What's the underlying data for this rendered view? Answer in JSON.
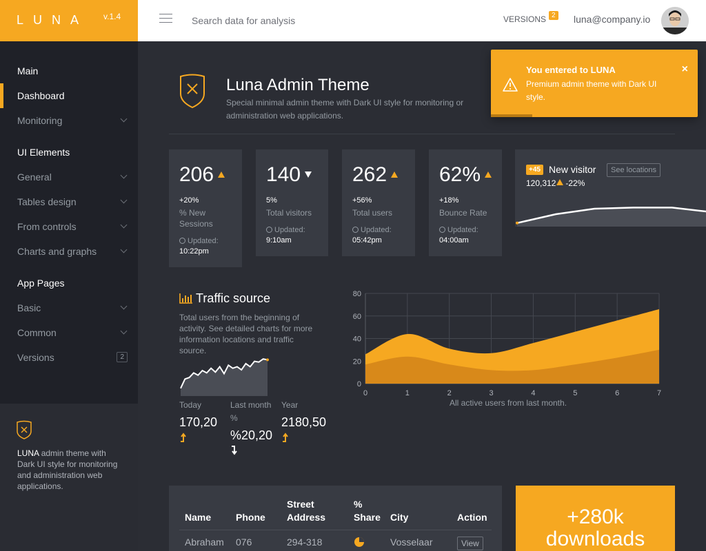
{
  "brand": {
    "name": "LUNA",
    "version": "v.1.4"
  },
  "header": {
    "search_placeholder": "Search data for analysis",
    "versions_label": "VERSIONS",
    "versions_count": "2",
    "user_email": "luna@company.io"
  },
  "sidebar": {
    "sections": [
      {
        "label": "Main"
      },
      {
        "label": "UI Elements"
      },
      {
        "label": "App Pages"
      }
    ],
    "items": [
      {
        "label": "Dashboard"
      },
      {
        "label": "Monitoring"
      },
      {
        "label": "General"
      },
      {
        "label": "Tables design"
      },
      {
        "label": "From controls"
      },
      {
        "label": "Charts and graphs"
      },
      {
        "label": "Basic"
      },
      {
        "label": "Common"
      },
      {
        "label": "Versions",
        "count": "2"
      }
    ],
    "footer": {
      "brand": "LUNA",
      "text": " admin theme with Dark UI style for monitoring and administration web applications."
    }
  },
  "page": {
    "title": "Luna Admin Theme",
    "description": "Special minimal admin theme with Dark UI style for monitoring or administration web applications."
  },
  "toast": {
    "title": "You entered to LUNA",
    "message": "Premium admin theme with Dark UI style.",
    "progress": 0.2
  },
  "stats": [
    {
      "value": "206",
      "trend": "up",
      "change": "+20%",
      "label": "% New Sessions",
      "updated_label": "Updated:",
      "time": "10:22pm"
    },
    {
      "value": "140",
      "trend": "down",
      "change": "5%",
      "label": "Total visitors",
      "updated_label": "Updated:",
      "time": "9:10am"
    },
    {
      "value": "262",
      "trend": "up",
      "change": "+56%",
      "label": "Total users",
      "updated_label": "Updated:",
      "time": "05:42pm"
    },
    {
      "value": "62%",
      "trend": "up",
      "change": "+18%",
      "label": "Bounce Rate",
      "updated_label": "Updated:",
      "time": "04:00am"
    }
  ],
  "visitor": {
    "badge": "+45",
    "title": "New visitor",
    "button": "See locations",
    "count": "120,312",
    "change": "-22%",
    "trend": [
      2,
      10,
      15,
      16,
      16,
      12,
      16
    ]
  },
  "traffic": {
    "title": "Traffic source",
    "description": "Total users from the beginning of activity. See detailed charts for more information locations and traffic source.",
    "sparkline": [
      10,
      22,
      24,
      30,
      27,
      33,
      30,
      36,
      31,
      38,
      29,
      40,
      36,
      38,
      34,
      42,
      38,
      45,
      44,
      48,
      47
    ],
    "columns": [
      {
        "label": "Today",
        "value": "170,20",
        "direction": "up"
      },
      {
        "label": "Last month %",
        "value": "%20,20",
        "direction": "down"
      },
      {
        "label": "Year",
        "value": "2180,50",
        "direction": "up"
      }
    ]
  },
  "chart_data": {
    "type": "area",
    "x": [
      0,
      1,
      2,
      3,
      4,
      5,
      6,
      7
    ],
    "series": [
      {
        "values": [
          26,
          44,
          31,
          27,
          36,
          46,
          56,
          66
        ],
        "color": "#f6a821"
      },
      {
        "values": [
          17,
          24,
          17,
          12,
          12,
          17,
          23,
          30
        ],
        "color": "#d8891a"
      }
    ],
    "xlim": [
      0,
      7
    ],
    "ylim": [
      0,
      80
    ],
    "yticks": [
      0,
      20,
      40,
      60,
      80
    ],
    "caption": "All active users from last month.",
    "grid": true
  },
  "table": {
    "headers": [
      "Name",
      "Phone",
      "Street Address",
      "% Share",
      "City",
      "Action"
    ],
    "rows": [
      {
        "name": "Abraham",
        "phone": "076",
        "address": "294-318",
        "city": "Vosselaar",
        "action": "View"
      }
    ]
  },
  "downloads": {
    "text": "+280k downloads"
  },
  "colors": {
    "accent": "#f6a821",
    "bg": "#2b2d34",
    "panel": "#383b43",
    "sidebar": "#1f2128"
  }
}
